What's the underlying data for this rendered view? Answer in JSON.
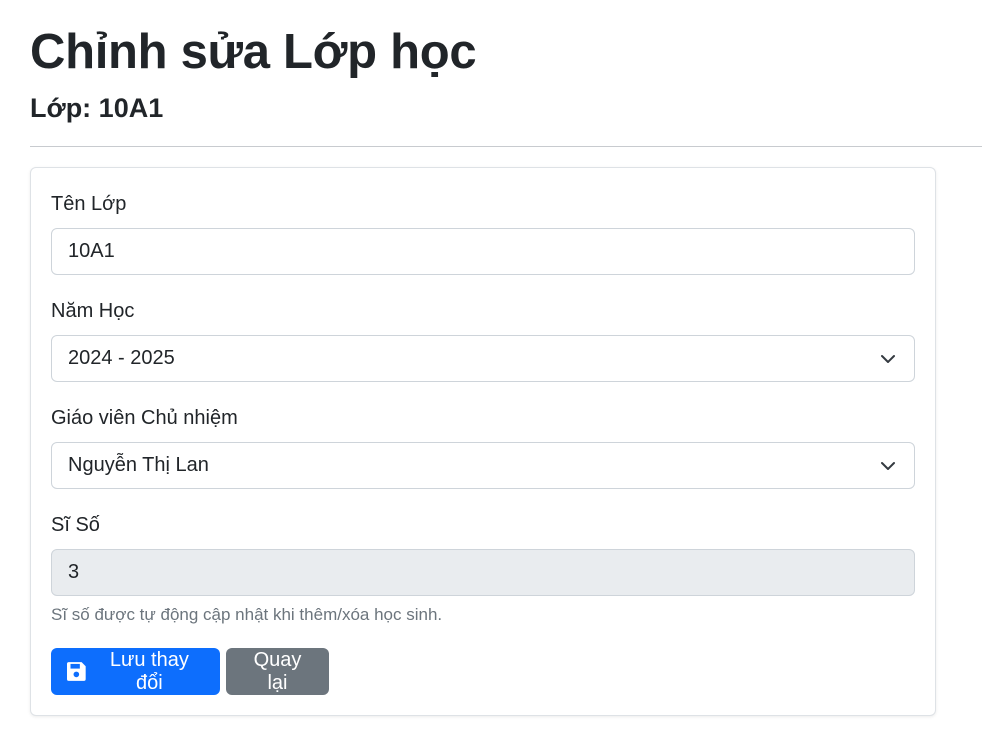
{
  "header": {
    "title": "Chỉnh sửa Lớp học",
    "subtitle": "Lớp: 10A1"
  },
  "form": {
    "class_name": {
      "label": "Tên Lớp",
      "value": "10A1"
    },
    "school_year": {
      "label": "Năm Học",
      "selected": "2024 - 2025"
    },
    "homeroom_teacher": {
      "label": "Giáo viên Chủ nhiệm",
      "selected": "Nguyễn Thị Lan"
    },
    "class_size": {
      "label": "Sĩ Số",
      "value": "3",
      "help": "Sĩ số được tự động cập nhật khi thêm/xóa học sinh."
    }
  },
  "actions": {
    "save_label": "Lưu thay đổi",
    "back_label": "Quay lại"
  },
  "colors": {
    "primary": "#0d6efd",
    "secondary": "#6c757d",
    "disabled_bg": "#e9ecef"
  },
  "icons": {
    "save": "floppy-disk-icon",
    "select": "chevron-down-icon"
  }
}
